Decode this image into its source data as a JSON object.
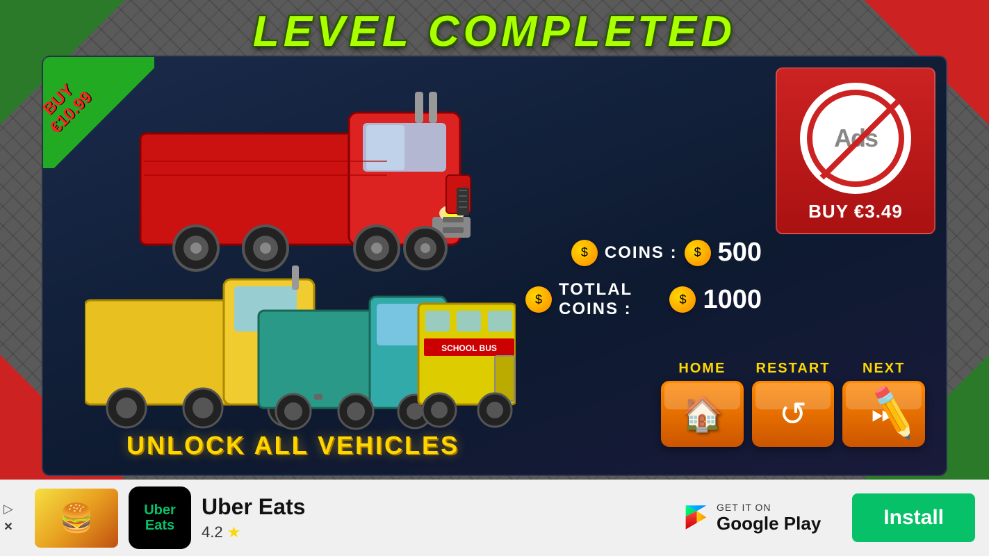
{
  "game": {
    "title": "LEVEL COMPLETED",
    "buy_banner": {
      "line1": "BUY",
      "line2": "€10.99"
    },
    "no_ads": {
      "label": "Ads",
      "price": "BUY €3.49"
    },
    "stats": {
      "coins_label": "COINS :",
      "coins_value": "500",
      "total_coins_label": "TOTLAL COINS :",
      "total_coins_value": "1000"
    },
    "buttons": {
      "home_label": "HOME",
      "restart_label": "RESTART",
      "next_label": "NEXT"
    },
    "unlock_text": "UNLOCK ALL VEHICLES"
  },
  "ad": {
    "app_name": "Uber Eats",
    "rating": "4.2",
    "star": "★",
    "google_play_label": "Google Play",
    "install_label": "Install",
    "logo_text_line1": "Uber",
    "logo_text_line2": "Eats"
  }
}
